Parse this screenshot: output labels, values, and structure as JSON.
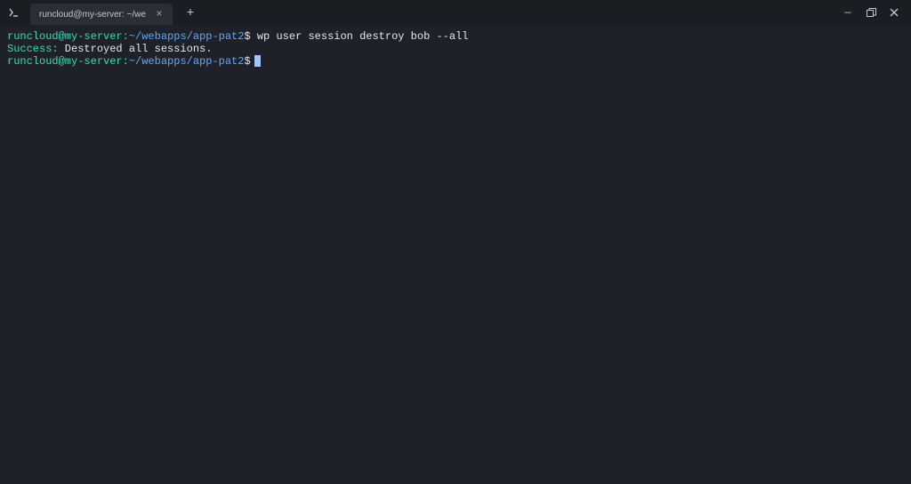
{
  "titlebar": {
    "tab_title": "runcloud@my-server: ~/webapps/a",
    "close_glyph": "×",
    "new_tab_glyph": "+",
    "minimize_glyph": "—"
  },
  "terminal": {
    "lines": [
      {
        "user": "runcloud@my-server",
        "sep": ":",
        "path": "~/webapps/app-pat2",
        "dollar": "$",
        "command": " wp user session destroy bob --all"
      },
      {
        "success_label": "Success:",
        "success_msg": " Destroyed all sessions."
      },
      {
        "user": "runcloud@my-server",
        "sep": ":",
        "path": "~/webapps/app-pat2",
        "dollar": "$",
        "command": ""
      }
    ]
  }
}
